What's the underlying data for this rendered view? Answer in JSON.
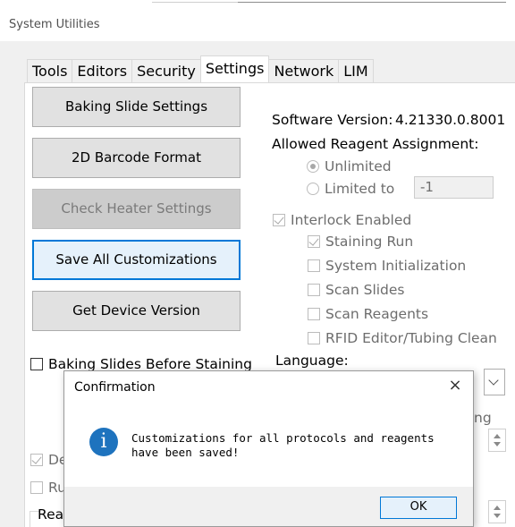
{
  "window": {
    "title": "System Utilities"
  },
  "tabs": [
    {
      "label": "Tools",
      "active": false
    },
    {
      "label": "Editors",
      "active": false
    },
    {
      "label": "Security",
      "active": false
    },
    {
      "label": "Settings",
      "active": true
    },
    {
      "label": "Network",
      "active": false
    },
    {
      "label": "LIM",
      "active": false
    }
  ],
  "buttons": {
    "baking_slide_settings": "Baking Slide Settings",
    "barcode_format": "2D Barcode Format",
    "check_heater_settings": "Check Heater Settings",
    "save_all_customizations": "Save All Customizations",
    "get_device_version": "Get Device Version"
  },
  "left_checkboxes": {
    "baking_slides": {
      "label": "Baking Slides Before Staining",
      "checked": false
    },
    "partial_de": {
      "label": "De",
      "checked": true
    },
    "partial_ru": {
      "label": "Ru",
      "checked": false
    },
    "partial_rea": {
      "label": "Rea"
    }
  },
  "software_version": {
    "label": "Software Version:",
    "value": "4.21330.0.8001"
  },
  "allowed_reagent": {
    "heading": "Allowed Reagent Assignment:",
    "unlimited": "Unlimited",
    "limited_to": "Limited to",
    "limit_value": "-1",
    "selected": "Unlimited"
  },
  "interlock": {
    "label": "Interlock Enabled",
    "checked": true,
    "items": [
      {
        "label": "Staining Run",
        "checked": true
      },
      {
        "label": "System Initialization",
        "checked": false
      },
      {
        "label": "Scan Slides",
        "checked": false
      },
      {
        "label": "Scan Reagents",
        "checked": false
      },
      {
        "label": "RFID Editor/Tubing Clean",
        "checked": false
      }
    ]
  },
  "language": {
    "label": "Language:"
  },
  "partial_right_label": "ng",
  "dialog": {
    "title": "Confirmation",
    "close_glyph": "×",
    "icon": "info-icon",
    "icon_glyph": "i",
    "message": "Customizations for all protocols and reagents have been saved!",
    "ok_label": "OK"
  },
  "colors": {
    "accent": "#0078d7",
    "info_icon": "#1e73be",
    "window_bg": "#f0f0f0"
  }
}
